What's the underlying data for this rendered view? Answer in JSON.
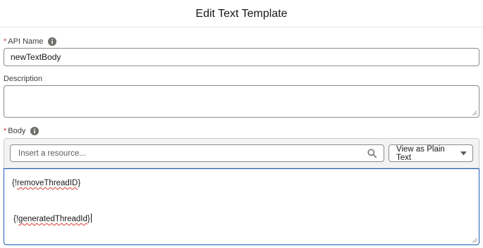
{
  "header": {
    "title": "Edit Text Template"
  },
  "fields": {
    "api_name": {
      "required_mark": "*",
      "label": "API Name",
      "value": "newTextBody"
    },
    "description": {
      "label": "Description",
      "value": ""
    },
    "body": {
      "required_mark": "*",
      "label": "Body",
      "resource_placeholder": "Insert a resource...",
      "view_button_label": "View as Plain Text",
      "content": {
        "line1_prefix": "{!",
        "line1_word": "removeThreadID",
        "line1_suffix": "}",
        "line2_prefix": "{!",
        "line2_word": "generatedThreadId",
        "line2_suffix": "}"
      }
    }
  },
  "colors": {
    "required": "#c23934",
    "focus_border": "#1b5fb5",
    "info_icon": "#706e6b"
  },
  "icons": {
    "info": "info-icon",
    "search": "search-icon",
    "dropdown": "chevron-down-icon",
    "resize": "resize-grip-icon"
  }
}
